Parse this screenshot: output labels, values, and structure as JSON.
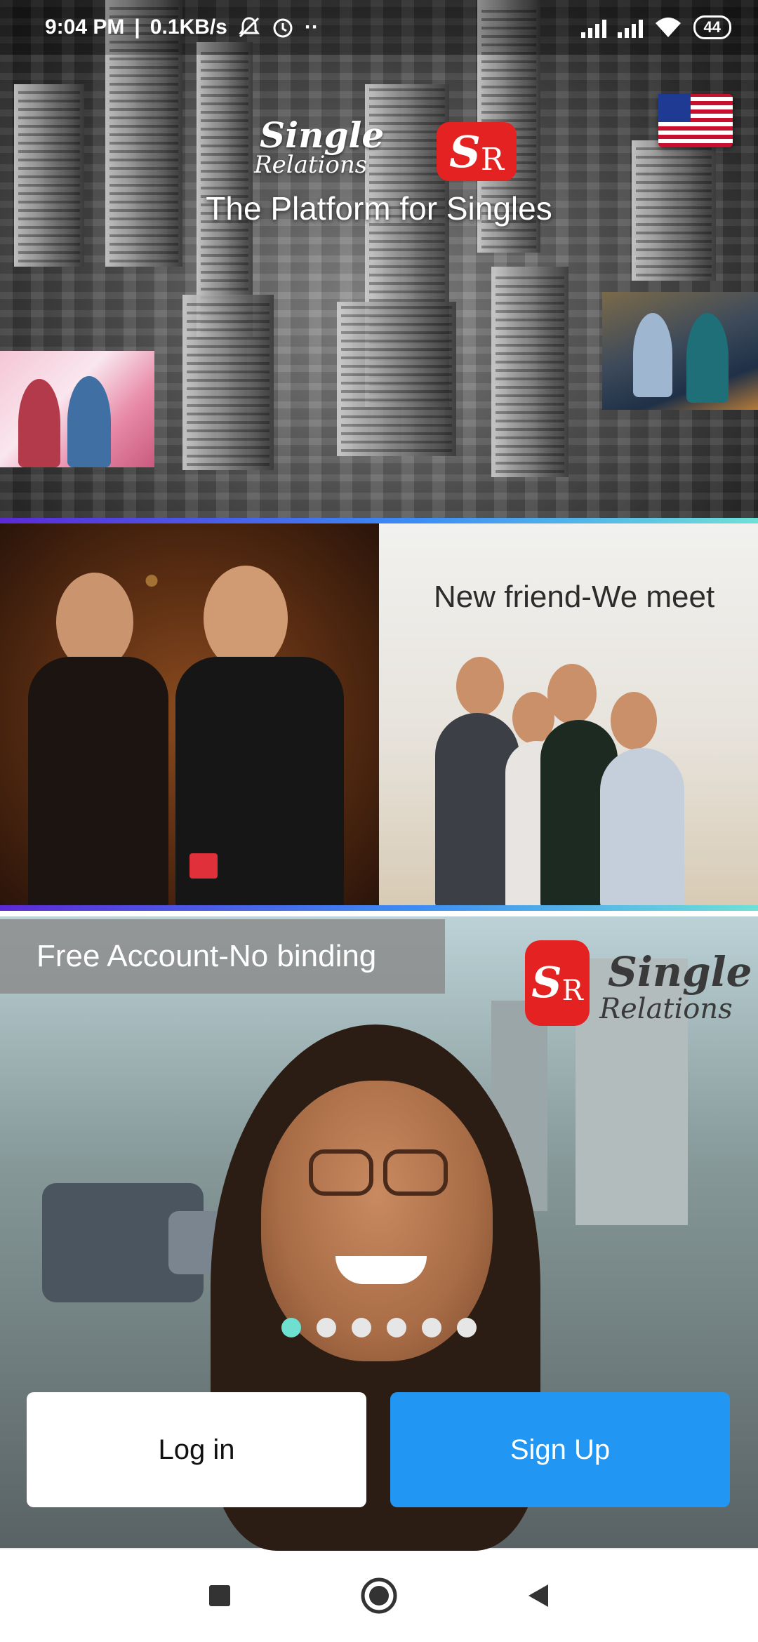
{
  "status_bar": {
    "time": "9:04 PM",
    "net_speed": "0.1KB/s",
    "battery": "44"
  },
  "hero": {
    "brand_word": "Single",
    "brand_sub": "Relations",
    "logo_s": "S",
    "logo_r": "R",
    "tagline": "The Platform for Singles"
  },
  "middle": {
    "title": "New friend-We meet"
  },
  "bottom": {
    "banner": "Free Account-No binding",
    "brand_word": "Single",
    "brand_sub": "Relations",
    "logo_s": "S",
    "logo_r": "R"
  },
  "carousel": {
    "total": 6,
    "active_index": 0
  },
  "actions": {
    "login_label": "Log in",
    "signup_label": "Sign Up"
  },
  "colors": {
    "accent_blue": "#2196f3",
    "logo_red": "#e52222",
    "dot_active": "#6fe0d0"
  },
  "icons": {
    "status": [
      "mute-bell-icon",
      "alarm-icon",
      "signal-icon",
      "wifi-icon",
      "battery-icon"
    ],
    "nav": [
      "recents-square-icon",
      "home-circle-icon",
      "back-triangle-icon"
    ],
    "language": "us-flag-icon"
  }
}
